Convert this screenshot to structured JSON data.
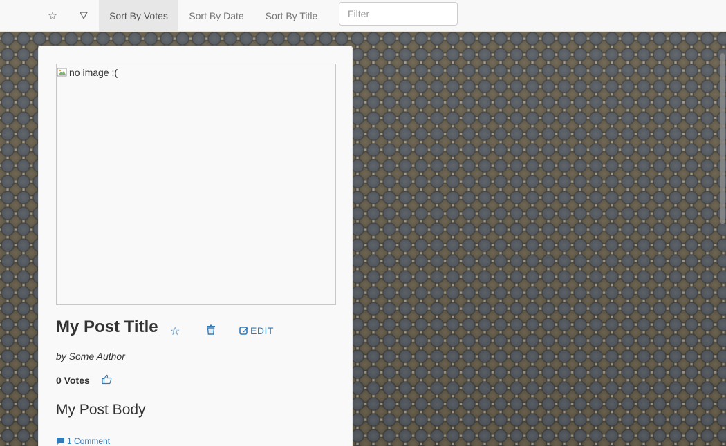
{
  "navbar": {
    "favorites_icon": "star-outline-icon",
    "filter_icon": "triangle-down-icon",
    "tabs": [
      {
        "label": "Sort By Votes",
        "active": true
      },
      {
        "label": "Sort By Date",
        "active": false
      },
      {
        "label": "Sort By Title",
        "active": false
      }
    ],
    "filter_placeholder": "Filter"
  },
  "post": {
    "image_alt": "no image :(",
    "title": "My Post Title",
    "edit_label": "EDIT",
    "author": "by Some Author",
    "votes": "0 Votes",
    "body": "My Post Body",
    "comments": "1 Comment"
  },
  "colors": {
    "link": "#337ab7",
    "active_tab_bg": "#e7e7e7",
    "card_bg": "#f9f9f9"
  }
}
